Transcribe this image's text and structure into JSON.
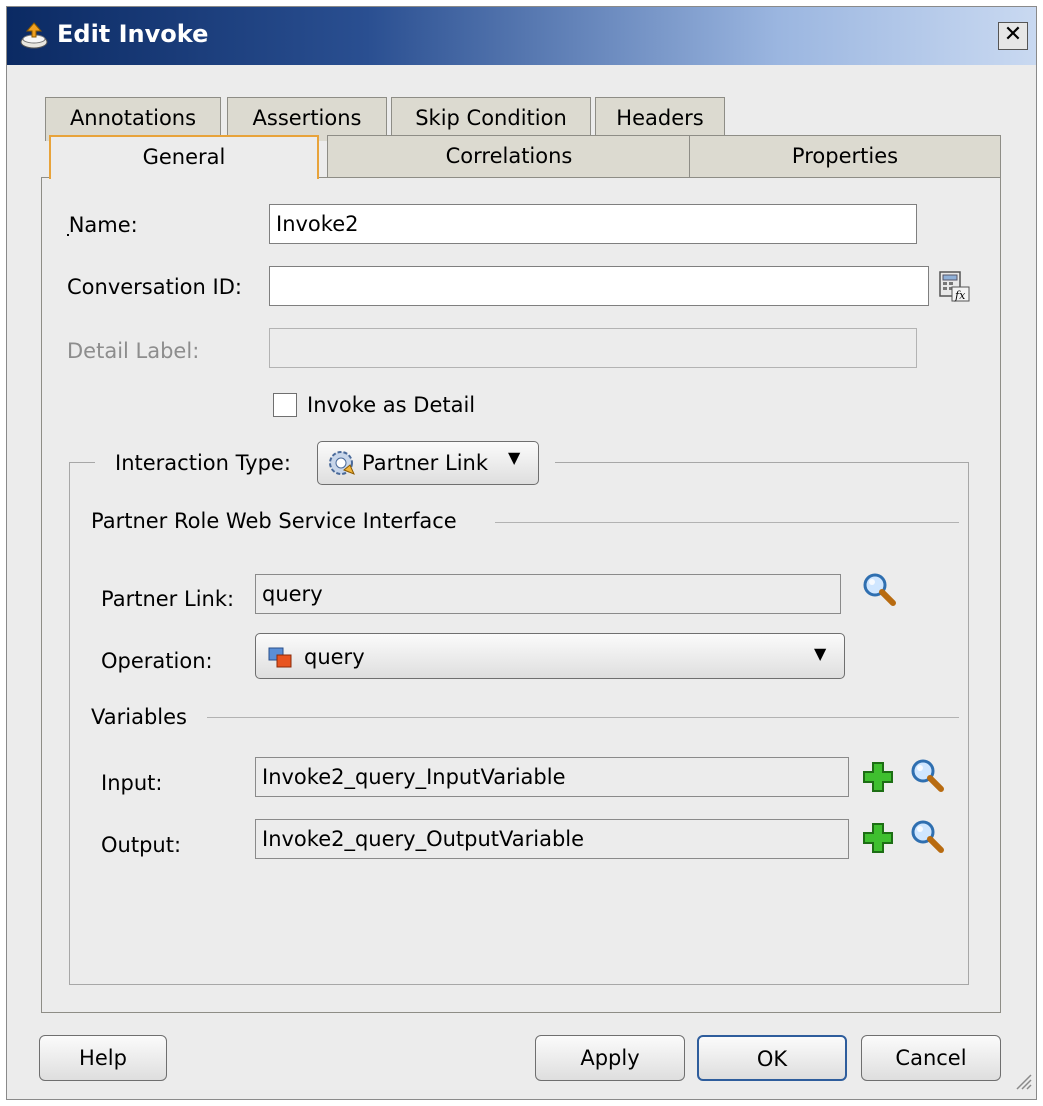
{
  "window": {
    "title": "Edit Invoke",
    "close_label": "✕"
  },
  "tabs_row1": [
    {
      "label": "Annotations"
    },
    {
      "label": "Assertions"
    },
    {
      "label": "Skip Condition"
    },
    {
      "label": "Headers"
    }
  ],
  "tabs_row2": [
    {
      "label": "General",
      "active": true
    },
    {
      "label": "Correlations"
    },
    {
      "label": "Properties"
    }
  ],
  "general": {
    "name_label": "Name:",
    "name_value": "Invoke2",
    "conversation_label": "Conversation ID:",
    "conversation_value": "",
    "detail_label": "Detail Label:",
    "detail_value": "",
    "invoke_as_detail_label": "Invoke as Detail",
    "invoke_as_detail_checked": false
  },
  "interaction": {
    "label": "Interaction Type:",
    "value": "Partner Link",
    "section_title": "Partner Role Web Service Interface",
    "partner_link_label": "Partner Link:",
    "partner_link_value": "query",
    "operation_label": "Operation:",
    "operation_value": "query",
    "variables_title": "Variables",
    "input_label": "Input:",
    "input_value": "Invoke2_query_InputVariable",
    "output_label": "Output:",
    "output_value": "Invoke2_query_OutputVariable"
  },
  "icons": {
    "expression": "expression-builder-icon",
    "search": "search-magnifier-icon",
    "add": "add-plus-icon",
    "operation": "operation-icon",
    "partner_link_type": "partner-link-gear-icon",
    "title": "invoke-icon"
  },
  "buttons": {
    "help": "Help",
    "apply": "Apply",
    "ok": "OK",
    "cancel": "Cancel"
  }
}
